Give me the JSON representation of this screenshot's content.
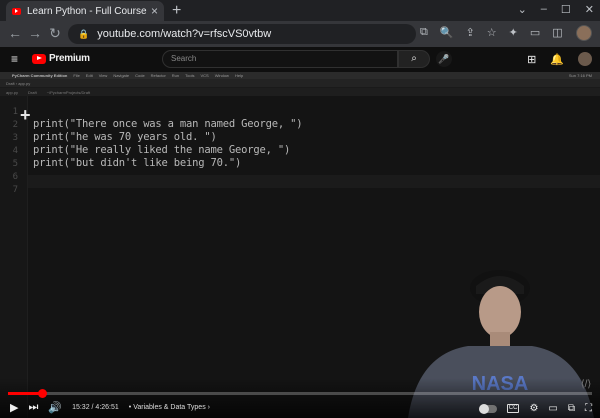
{
  "browser": {
    "tab_title": "Learn Python - Full Course for B",
    "tab_close": "×",
    "new_tab": "+",
    "url": "youtube.com/watch?v=rfscVS0vtbw",
    "back": "←",
    "forward": "→",
    "reload": "↻",
    "window_controls": [
      "⌄",
      "–",
      "☐",
      "✕"
    ],
    "toolbar_icons": [
      "⧉",
      "🔍",
      "⇪",
      "☆",
      "✦",
      "▭",
      "◫"
    ]
  },
  "youtube": {
    "menu": "≡",
    "brand": "Premium",
    "search_placeholder": "Search",
    "search_button": "⌕",
    "mic": "🎤",
    "right_icons": [
      "⊞",
      "🔔"
    ]
  },
  "ide": {
    "app_name": "PyCharm Community Edition",
    "menu_items": [
      "File",
      "Edit",
      "View",
      "Navigate",
      "Code",
      "Refactor",
      "Run",
      "Tools",
      "VCS",
      "Window",
      "Help"
    ],
    "clock": "Sun 7:16 PM",
    "toolbar_text": "Draft  ›  app.py",
    "tab_labels": [
      "app.py",
      "Draft",
      "~/PycharmProjects/Draft"
    ],
    "line_numbers": [
      "1",
      "2",
      "3",
      "4",
      "5",
      "6",
      "7"
    ],
    "code_lines": [
      "",
      "print(\"There once was a man named George, \")",
      "print(\"he was 70 years old. \")",
      "print(\"He really liked the name George, \")",
      "print(\"but didn't like being 70.\")",
      "",
      ""
    ]
  },
  "player": {
    "current_time": "15:32",
    "duration": "4:26:51",
    "time_display": "15:32 / 4:26:51",
    "chapter": "• Variables & Data Types ›",
    "progress_fraction": 0.058,
    "cc_label": "CC",
    "play": "▶",
    "next": "⏭",
    "volume": "🔊",
    "right_icons": [
      "⚙",
      "▭",
      "⧉",
      "⛶"
    ],
    "watermark": "⟨/⟩",
    "person_shirt_text": "NASA"
  },
  "colors": {
    "yt_red": "#ff0000",
    "chrome_dark": "#202124",
    "chrome_toolbar": "#35363a",
    "code_text": "#b8b8b8"
  }
}
